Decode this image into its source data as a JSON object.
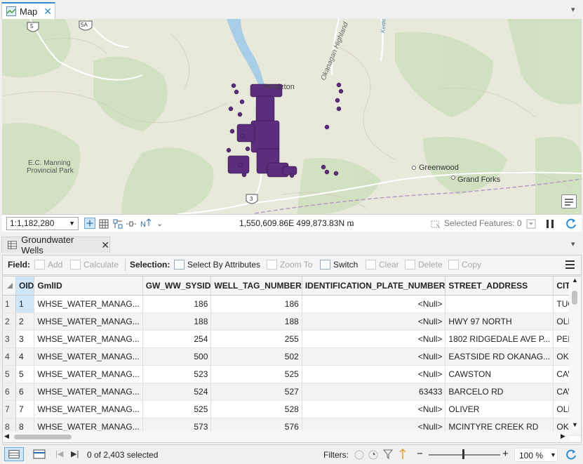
{
  "map_tab": {
    "label": "Map"
  },
  "map": {
    "labels": {
      "penticton": "Penticton",
      "okanagan_highland": "Okanagan Highland",
      "ec_manning_1": "E.C. Manning",
      "ec_manning_2": "Provincial Park",
      "greenwood": "Greenwood",
      "grand_forks": "Grand Forks",
      "kettle": "Kettle",
      "hwy5": "5",
      "hwy5a": "5A",
      "hwy3": "3"
    },
    "colors": {
      "terrain": "#e6e8d8",
      "forest": "#cfe0bf",
      "water": "#a8cde6",
      "points": "#5b2d7c"
    }
  },
  "map_status": {
    "scale": "1:1,182,280",
    "coordinates": "1,550,609.86E 499,873.83N m",
    "selected_features": "Selected Features: 0"
  },
  "attr_tab": {
    "label": "Groundwater Wells"
  },
  "toolbar": {
    "field_label": "Field:",
    "add": "Add",
    "calculate": "Calculate",
    "selection_label": "Selection:",
    "select_by_attributes": "Select By Attributes",
    "zoom_to": "Zoom To",
    "switch": "Switch",
    "clear": "Clear",
    "delete": "Delete",
    "copy": "Copy"
  },
  "table": {
    "columns": [
      "OID",
      "GmlID",
      "GW_WW_SYSID",
      "WELL_TAG_NUMBER",
      "IDENTIFICATION_PLATE_NUMBER",
      "STREET_ADDRESS",
      "CITY"
    ],
    "rows": [
      [
        "1",
        "1",
        "WHSE_WATER_MANAG...",
        "186",
        "186",
        "<Null>",
        "",
        "TUGELNUIT LAKE"
      ],
      [
        "2",
        "2",
        "WHSE_WATER_MANAG...",
        "188",
        "188",
        "<Null>",
        "HWY 97 NORTH",
        "OLIVER"
      ],
      [
        "3",
        "3",
        "WHSE_WATER_MANAG...",
        "254",
        "255",
        "<Null>",
        "1802 RIDGEDALE AVE P...",
        "PENTICTON"
      ],
      [
        "4",
        "4",
        "WHSE_WATER_MANAG...",
        "500",
        "502",
        "<Null>",
        "EASTSIDE RD OKANAG...",
        "OKANAGAN FALLS"
      ],
      [
        "5",
        "5",
        "WHSE_WATER_MANAG...",
        "523",
        "525",
        "<Null>",
        "CAWSTON",
        "CAWSTON"
      ],
      [
        "6",
        "6",
        "WHSE_WATER_MANAG...",
        "524",
        "527",
        "63433",
        "BARCELO RD",
        "CAWSTON, BC"
      ],
      [
        "7",
        "7",
        "WHSE_WATER_MANAG...",
        "525",
        "528",
        "<Null>",
        "OLIVER",
        "OLIVER"
      ],
      [
        "8",
        "8",
        "WHSE_WATER_MANAG...",
        "573",
        "576",
        "<Null>",
        "MCINTYRE CREEK RD",
        "OKANAGAN FALLS"
      ]
    ]
  },
  "bottom_bar": {
    "selected_count": "0 of 2,403 selected",
    "filters_label": "Filters:",
    "zoom": "100 %"
  }
}
